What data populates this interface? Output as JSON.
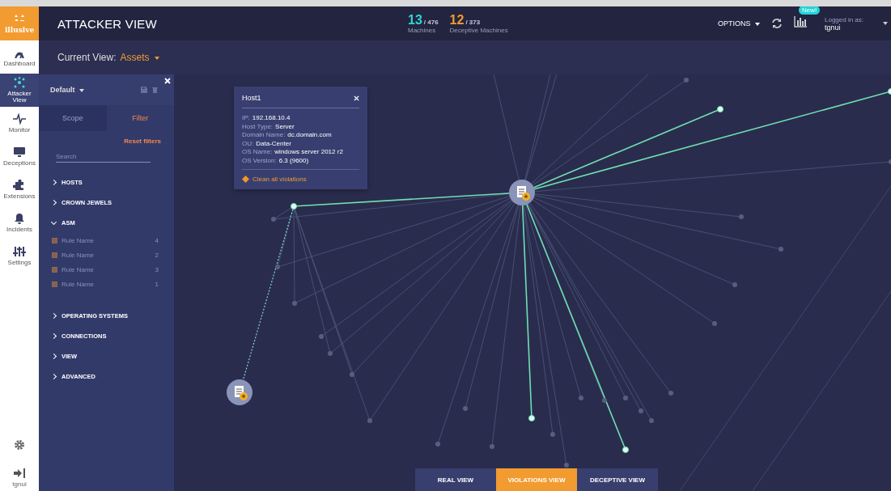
{
  "app": {
    "logo": "illusive",
    "title": "ATTACKER VIEW"
  },
  "stats": [
    {
      "value": "13",
      "total": "/ 476",
      "label": "Machines",
      "kind": "real"
    },
    {
      "value": "12",
      "total": "/ 373",
      "label": "Deceptive Machines",
      "kind": "deceptive"
    }
  ],
  "header": {
    "options": "OPTIONS",
    "badge": "New!",
    "logged_in_label": "Logged in as:",
    "user": "tgnui"
  },
  "nav": [
    {
      "label": "Dashboard",
      "selected": false
    },
    {
      "label": "Attacker View",
      "selected": true
    },
    {
      "label": "Monitor",
      "selected": false
    },
    {
      "label": "Deceptions",
      "selected": false
    },
    {
      "label": "Extensions",
      "selected": false
    },
    {
      "label": "Incidents",
      "selected": false
    },
    {
      "label": "Settings",
      "selected": false
    }
  ],
  "nav_footer": {
    "user": "tgnui"
  },
  "current_view": {
    "label": "Current View:",
    "value": "Assets"
  },
  "filter_panel": {
    "preset": "Default",
    "tabs": [
      {
        "label": "Scope",
        "selected": false
      },
      {
        "label": "Filter",
        "selected": true
      }
    ],
    "reset": "Reset filters",
    "search": {
      "placeholder": "Search"
    },
    "sections": [
      {
        "label": "HOSTS",
        "expanded": false
      },
      {
        "label": "CROWN JEWELS",
        "expanded": false
      },
      {
        "label": "ASM",
        "expanded": true,
        "rules": [
          {
            "name": "Rule Name",
            "count": "4",
            "checked": true
          },
          {
            "name": "Rule Name",
            "count": "2",
            "checked": true
          },
          {
            "name": "Rule Name",
            "count": "3",
            "checked": true
          },
          {
            "name": "Rule Name",
            "count": "1",
            "checked": true
          }
        ]
      },
      {
        "label": "OPERATING SYSTEMS",
        "expanded": false
      },
      {
        "label": "CONNECTIONS",
        "expanded": false
      },
      {
        "label": "VIEW",
        "expanded": false
      },
      {
        "label": "ADVANCED",
        "expanded": false
      }
    ]
  },
  "popup": {
    "title": "Host1",
    "fields": [
      {
        "label": "IP:",
        "value": "192.168.10.4"
      },
      {
        "label": "Host Type:",
        "value": "Server"
      },
      {
        "label": "Domain Name:",
        "value": "dc.domain.com"
      },
      {
        "label": "OU:",
        "value": "Data-Center"
      },
      {
        "label": "OS Name:",
        "value": "windows server 2012 r2"
      },
      {
        "label": "OS Version:",
        "value": "6.3 (9600)"
      }
    ],
    "action": "Clean all violations"
  },
  "view_tabs": [
    {
      "label": "REAL VIEW",
      "selected": false
    },
    {
      "label": "VIOLATIONS VIEW",
      "selected": true
    },
    {
      "label": "DECEPTIVE VIEW",
      "selected": false
    }
  ]
}
